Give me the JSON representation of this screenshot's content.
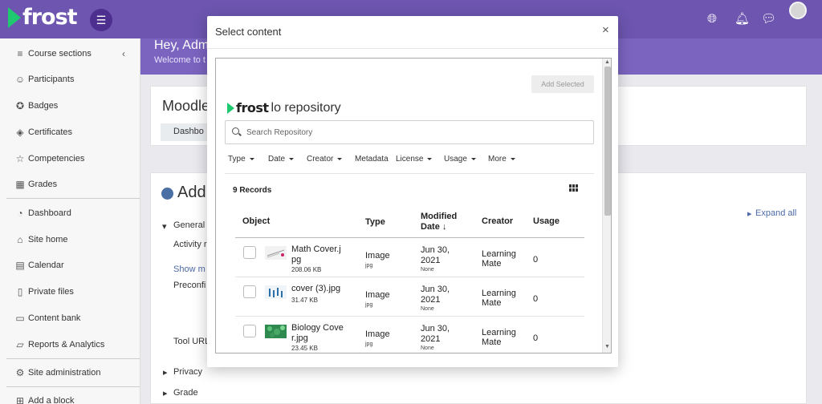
{
  "app": {
    "logo": "frost"
  },
  "sidebar": {
    "items": [
      {
        "label": "Course sections",
        "icon": "list-icon"
      },
      {
        "label": "Participants",
        "icon": "users-icon"
      },
      {
        "label": "Badges",
        "icon": "badge-icon"
      },
      {
        "label": "Certificates",
        "icon": "certificate-icon"
      },
      {
        "label": "Competencies",
        "icon": "star-icon"
      },
      {
        "label": "Grades",
        "icon": "table-icon"
      },
      {
        "label": "Dashboard",
        "icon": "dashboard-icon"
      },
      {
        "label": "Site home",
        "icon": "home-icon"
      },
      {
        "label": "Calendar",
        "icon": "calendar-icon"
      },
      {
        "label": "Private files",
        "icon": "file-icon"
      },
      {
        "label": "Content bank",
        "icon": "clipboard-icon"
      },
      {
        "label": "Reports & Analytics",
        "icon": "folder-icon"
      },
      {
        "label": "Site administration",
        "icon": "gear-icon"
      },
      {
        "label": "Add a block",
        "icon": "plus-square-icon"
      }
    ]
  },
  "banner": {
    "greeting": "Hey, Adm",
    "sub": "Welcome to t"
  },
  "course": {
    "title": "Moodle",
    "tab": "Dashbo"
  },
  "form": {
    "title": "Add",
    "section_general": "General",
    "activity": "Activity r",
    "show_more": "Show m",
    "preconfig": "Preconfi",
    "tool_url": "Tool URL",
    "privacy": "Privacy",
    "grade": "Grade",
    "expand_all": "Expand all"
  },
  "modal": {
    "title": "Select content",
    "close": "×",
    "add_selected": "Add Selected",
    "repo_brand": "frost",
    "repo_suffix": "lo repository",
    "search_placeholder": "Search Repository",
    "filters": [
      {
        "label": "Type",
        "caret": true
      },
      {
        "label": "Date",
        "caret": true
      },
      {
        "label": "Creator",
        "caret": true
      },
      {
        "label": "Metadata",
        "caret": false
      },
      {
        "label": "License",
        "caret": true
      },
      {
        "label": "Usage",
        "caret": true
      },
      {
        "label": "More",
        "caret": true
      }
    ],
    "records": "9 Records",
    "columns": {
      "object": "Object",
      "type": "Type",
      "modified": "Modified Date ↓",
      "creator": "Creator",
      "usage": "Usage"
    },
    "rows": [
      {
        "name": "Math Cover.jpg",
        "size": "208.06 KB",
        "type": "Image",
        "type_sub": "jpg",
        "date": "Jun 30, 2021",
        "date_sub": "None",
        "creator": "Learning Mate",
        "usage": "0"
      },
      {
        "name": "cover (3).jpg",
        "size": "31.47 KB",
        "type": "Image",
        "type_sub": "jpg",
        "date": "Jun 30, 2021",
        "date_sub": "None",
        "creator": "Learning Mate",
        "usage": "0"
      },
      {
        "name": "Biology Cover.jpg",
        "size": "23.45 KB",
        "type": "Image",
        "type_sub": "jpg",
        "date": "Jun 30, 2021",
        "date_sub": "None",
        "creator": "Learning Mate",
        "usage": "0"
      }
    ]
  }
}
